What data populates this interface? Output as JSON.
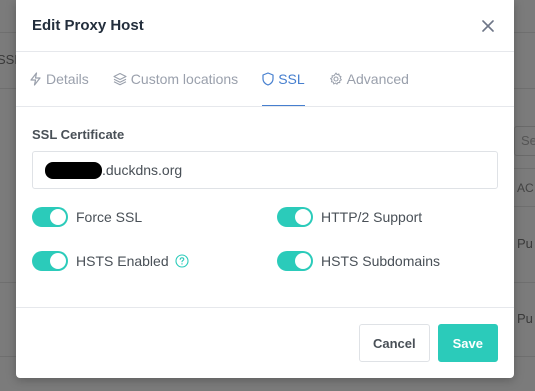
{
  "background": {
    "fragments": [
      "SSL",
      "Se",
      "AC",
      "Pu",
      "Pu"
    ]
  },
  "modal": {
    "title": "Edit Proxy Host",
    "close_icon": "close-icon"
  },
  "tabs": [
    {
      "label": "Details",
      "icon": "lightning-icon",
      "active": false
    },
    {
      "label": "Custom locations",
      "icon": "layers-icon",
      "active": false
    },
    {
      "label": "SSL",
      "icon": "shield-icon",
      "active": true
    },
    {
      "label": "Advanced",
      "icon": "gear-icon",
      "active": false
    }
  ],
  "ssl": {
    "certificate_label": "SSL Certificate",
    "certificate_value": ".duckdns.org",
    "toggles": [
      {
        "label": "Force SSL",
        "on": true
      },
      {
        "label": "HTTP/2 Support",
        "on": true
      },
      {
        "label": "HSTS Enabled",
        "on": true,
        "help": true
      },
      {
        "label": "HSTS Subdomains",
        "on": true
      }
    ]
  },
  "footer": {
    "cancel_label": "Cancel",
    "save_label": "Save"
  },
  "colors": {
    "accent": "#2bcbba",
    "active_tab": "#467fcf"
  }
}
